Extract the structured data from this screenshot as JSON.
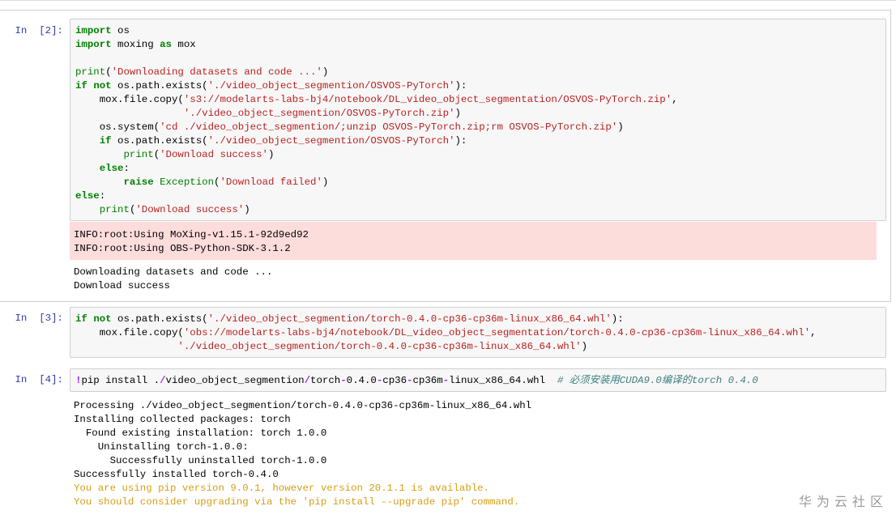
{
  "cells": [
    {
      "prompt": "In  [2]:",
      "code": [
        [
          [
            "kw",
            "import"
          ],
          [
            "t",
            " os"
          ]
        ],
        [
          [
            "kw",
            "import"
          ],
          [
            "t",
            " moxing "
          ],
          [
            "kw",
            "as"
          ],
          [
            "t",
            " mox"
          ]
        ],
        [],
        [
          [
            "bi",
            "print"
          ],
          [
            "t",
            "("
          ],
          [
            "str",
            "'Downloading datasets and code ...'"
          ],
          [
            "t",
            ")"
          ]
        ],
        [
          [
            "kw",
            "if"
          ],
          [
            "t",
            " "
          ],
          [
            "kw",
            "not"
          ],
          [
            "t",
            " os.path.exists("
          ],
          [
            "str",
            "'./video_object_segmention/OSVOS-PyTorch'"
          ],
          [
            "t",
            "):"
          ]
        ],
        [
          [
            "t",
            "    mox.file.copy("
          ],
          [
            "str",
            "'s3://modelarts-labs-bj4/notebook/DL_video_object_segmentation/OSVOS-PyTorch.zip'"
          ],
          [
            "t",
            ","
          ]
        ],
        [
          [
            "t",
            "                  "
          ],
          [
            "str",
            "'./video_object_segmention/OSVOS-PyTorch.zip'"
          ],
          [
            "t",
            ")"
          ]
        ],
        [
          [
            "t",
            "    os.system("
          ],
          [
            "str",
            "'cd ./video_object_segmention/;unzip OSVOS-PyTorch.zip;rm OSVOS-PyTorch.zip'"
          ],
          [
            "t",
            ")"
          ]
        ],
        [
          [
            "t",
            "    "
          ],
          [
            "kw",
            "if"
          ],
          [
            "t",
            " os.path.exists("
          ],
          [
            "str",
            "'./video_object_segmention/OSVOS-PyTorch'"
          ],
          [
            "t",
            "):"
          ]
        ],
        [
          [
            "t",
            "        "
          ],
          [
            "bi",
            "print"
          ],
          [
            "t",
            "("
          ],
          [
            "str",
            "'Download success'"
          ],
          [
            "t",
            ")"
          ]
        ],
        [
          [
            "t",
            "    "
          ],
          [
            "kw",
            "else"
          ],
          [
            "t",
            ":"
          ]
        ],
        [
          [
            "t",
            "        "
          ],
          [
            "kw",
            "raise"
          ],
          [
            "t",
            " "
          ],
          [
            "bi",
            "Exception"
          ],
          [
            "t",
            "("
          ],
          [
            "str",
            "'Download failed'"
          ],
          [
            "t",
            ")"
          ]
        ],
        [
          [
            "kw",
            "else"
          ],
          [
            "t",
            ":"
          ]
        ],
        [
          [
            "t",
            "    "
          ],
          [
            "bi",
            "print"
          ],
          [
            "t",
            "("
          ],
          [
            "str",
            "'Download success'"
          ],
          [
            "t",
            ")"
          ]
        ]
      ],
      "stderr": [
        "INFO:root:Using MoXing-v1.15.1-92d9ed92",
        "INFO:root:Using OBS-Python-SDK-3.1.2"
      ],
      "stdout": [
        "Downloading datasets and code ...",
        "Download success"
      ]
    },
    {
      "prompt": "In  [3]:",
      "code": [
        [
          [
            "kw",
            "if"
          ],
          [
            "t",
            " "
          ],
          [
            "kw",
            "not"
          ],
          [
            "t",
            " os.path.exists("
          ],
          [
            "str",
            "'./video_object_segmention/torch-0.4.0-cp36-cp36m-linux_x86_64.whl'"
          ],
          [
            "t",
            "):"
          ]
        ],
        [
          [
            "t",
            "    mox.file.copy("
          ],
          [
            "str",
            "'obs://modelarts-labs-bj4/notebook/DL_video_object_segmentation/torch-0.4.0-cp36-cp36m-linux_x86_64.whl'"
          ],
          [
            "t",
            ","
          ]
        ],
        [
          [
            "t",
            "                 "
          ],
          [
            "str",
            "'./video_object_segmention/torch-0.4.0-cp36-cp36m-linux_x86_64.whl'"
          ],
          [
            "t",
            ")"
          ]
        ]
      ]
    },
    {
      "prompt": "In  [4]:",
      "code": [
        [
          [
            "op",
            "!"
          ],
          [
            "t",
            "pip install ."
          ],
          [
            "op",
            "/"
          ],
          [
            "t",
            "video_object_segmention"
          ],
          [
            "op",
            "/"
          ],
          [
            "t",
            "torch"
          ],
          [
            "op",
            "-"
          ],
          [
            "t",
            "0.4.0"
          ],
          [
            "op",
            "-"
          ],
          [
            "t",
            "cp36"
          ],
          [
            "op",
            "-"
          ],
          [
            "t",
            "cp36m"
          ],
          [
            "op",
            "-"
          ],
          [
            "t",
            "linux_x86_64.whl  "
          ],
          [
            "cm",
            "# 必须安装用CUDA9.0编译的torch 0.4.0"
          ]
        ]
      ],
      "stdout": [
        "Processing ./video_object_segmention/torch-0.4.0-cp36-cp36m-linux_x86_64.whl",
        "Installing collected packages: torch",
        "  Found existing installation: torch 1.0.0",
        "    Uninstalling torch-1.0.0:",
        "      Successfully uninstalled torch-1.0.0",
        "Successfully installed torch-0.4.0"
      ],
      "warnings": [
        "You are using pip version 9.0.1, however version 20.1.1 is available.",
        "You should consider upgrading via the 'pip install --upgrade pip' command."
      ]
    }
  ],
  "watermark": "华为云社区"
}
